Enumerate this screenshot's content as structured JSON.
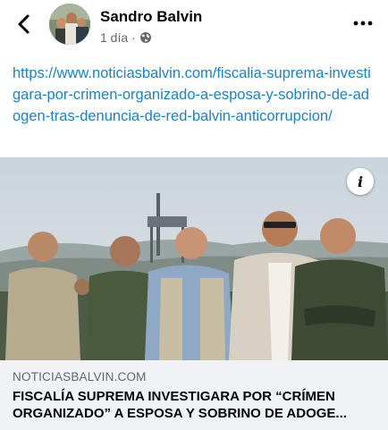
{
  "header": {
    "author_name": "Sandro Balvin",
    "timestamp": "1 día",
    "separator": "·",
    "privacy_icon": "globe-icon",
    "back_icon": "chevron-left-icon",
    "more_icon": "more-horizontal-icon"
  },
  "post": {
    "link_text": "https://www.noticiasbalvin.com/fiscalia-suprema-investigara-por-crimen-organizado-a-esposa-y-sobrino-de-adogen-tras-denuncia-de-red-balvin-anticorrupcion/"
  },
  "link_preview": {
    "domain": "NOTICIASBALVIN.COM",
    "title": "FISCALÍA SUPREMA INVESTIGARA POR “CRÍMEN ORGANIZADO” A ESPOSA Y SOBRINO DE ADOGE...",
    "info_label": "i"
  },
  "colors": {
    "link": "#1a82c9",
    "secondary_text": "#65676b",
    "card_background": "#f0f2f5"
  }
}
